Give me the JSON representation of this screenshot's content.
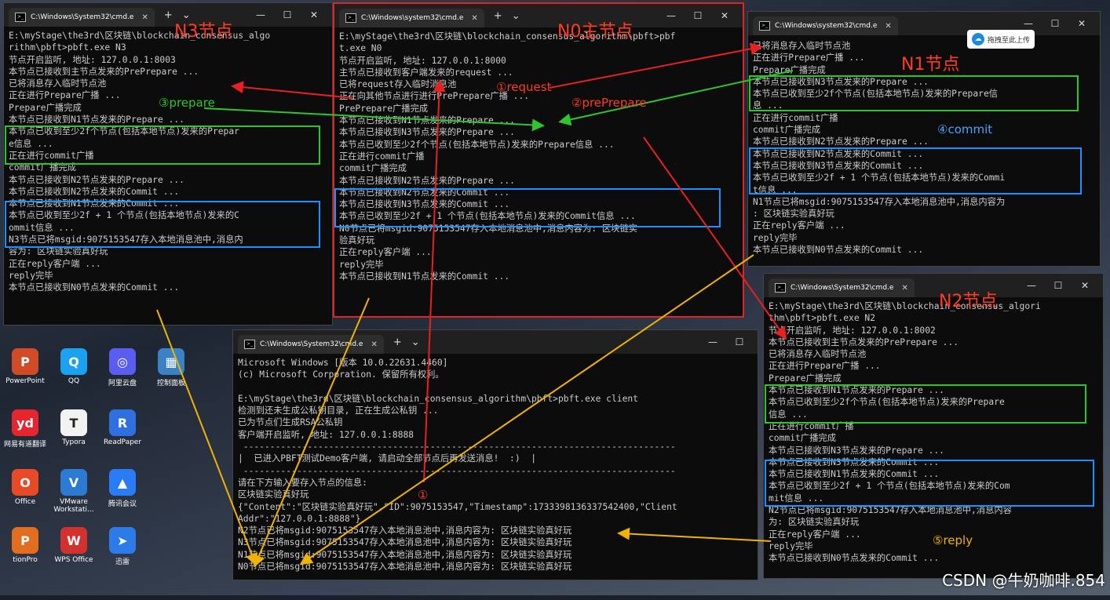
{
  "windows": {
    "n3": {
      "tab_title": "C:\\Windows\\System32\\cmd.e",
      "lines": [
        "E:\\myStage\\the3rd\\区块链\\blockchain_consensus_algo",
        "rithm\\pbft>pbft.exe N3",
        "节点开启监听, 地址: 127.0.0.1:8003",
        "本节点已接收到主节点发来的PrePrepare ...",
        "已将消息存入临时节点池",
        "正在进行Prepare广播 ...",
        "Prepare广播完成",
        "本节点已接收到N1节点发来的Prepare ...",
        "本节点已收到至少2f个节点(包括本地节点)发来的Prepar",
        "e信息 ...",
        "正在进行commit广播",
        "commit广播完成",
        "本节点已接收到N2节点发来的Prepare ...",
        "本节点已接收到N2节点发来的Commit ...",
        "本节点已接收到N1节点发来的Commit ...",
        "本节点已收到至少2f + 1 个节点(包括本地节点)发来的C",
        "ommit信息 ...",
        "N3节点已将msgid:9075153547存入本地消息池中,消息内",
        "容为: 区块链实验真好玩",
        "正在reply客户端 ...",
        "reply完毕",
        "本节点已接收到N0节点发来的Commit ..."
      ]
    },
    "n0": {
      "tab_title": "C:\\Windows\\system32\\cmd.e",
      "lines": [
        "E:\\myStage\\the3rd\\区块链\\blockchain_consensus_algorithm\\pbft>pbf",
        "t.exe N0",
        "节点开启监听, 地址: 127.0.0.1:8000",
        "主节点已接收到客户端发来的request ...",
        "已将request存入临时消息池",
        "正在向其他节点进行进行PrePrepare广播 ...",
        "PrePrepare广播完成",
        "本节点已接收到N1节点发来的Prepare ...",
        "本节点已接收到N3节点发来的Prepare ...",
        "本节点已收到至少2f个节点(包括本地节点)发来的Prepare信息 ...",
        "正在进行commit广播",
        "commit广播完成",
        "本节点已接收到N2节点发来的Prepare ...",
        "本节点已接收到N2节点发来的Commit ...",
        "本节点已接收到N3节点发来的Commit ...",
        "本节点已收到至少2f + 1 个节点(包括本地节点)发来的Commit信息 ...",
        "N0节点已将msgid:9075153547存入本地消息池中,消息内容为: 区块链实",
        "验真好玩",
        "正在reply客户端 ...",
        "reply完毕",
        "本节点已接收到N1节点发来的Commit ..."
      ]
    },
    "n1": {
      "tab_title": "C:\\Windows\\system32\\cmd.e",
      "lines": [
        "已将消息存入临时节点池",
        "正在进行Prepare广播 ...",
        "Prepare广播完成",
        "本节点已接收到N3节点发来的Prepare ...",
        "本节点已收到至少2f个节点(包括本地节点)发来的Prepare信",
        "息 ...",
        "正在进行commit广播",
        "commit广播完成",
        "本节点已接收到N2节点发来的Prepare ...",
        "本节点已接收到N2节点发来的Commit ...",
        "本节点已接收到N3节点发来的Commit ...",
        "本节点已收到至少2f + 1 个节点(包括本地节点)发来的Commi",
        "t信息 ...",
        "N1节点已将msgid:9075153547存入本地消息池中,消息内容为",
        ": 区块链实验真好玩",
        "正在reply客户端 ...",
        "reply完毕",
        "本节点已接收到N0节点发来的Commit ..."
      ]
    },
    "n2": {
      "tab_title": "C:\\Windows\\System32\\cmd.e",
      "lines": [
        "E:\\myStage\\the3rd\\区块链\\blockchain_consensus_algori",
        "thm\\pbft>pbft.exe N2",
        "节点开启监听, 地址: 127.0.0.1:8002",
        "本节点已接收到主节点发来的PrePrepare ...",
        "已将消息存入临时节点池",
        "正在进行Prepare广播 ...",
        "Prepare广播完成",
        "本节点已接收到N1节点发来的Prepare ...",
        "本节点已收到至少2f个节点(包括本地节点)发来的Prepare",
        "信息 ...",
        "正在进行commit广播",
        "commit广播完成",
        "本节点已接收到N3节点发来的Prepare ...",
        "本节点已接收到N3节点发来的Commit ...",
        "本节点已接收到N1节点发来的Commit ...",
        "本节点已收到至少2f + 1 个节点(包括本地节点)发来的Com",
        "mit信息 ...",
        "N2节点已将msgid:9075153547存入本地消息池中,消息内容",
        "为: 区块链实验真好玩",
        "正在reply客户端 ...",
        "reply完毕",
        "本节点已接收到N0节点发来的Commit ..."
      ]
    },
    "client": {
      "tab_title": "C:\\Windows\\System32\\cmd.e",
      "lines": [
        "Microsoft Windows [版本 10.0.22631.4460]",
        "(c) Microsoft Corporation. 保留所有权利。",
        "",
        "E:\\myStage\\the3rd\\区块链\\blockchain_consensus_algorithm\\pbft>pbft.exe client",
        "检测到还未生成公私钥目录, 正在生成公私钥 ...",
        "已为节点们生成RSA公私钥",
        "客户端开启监听, 地址: 127.0.0.1:8888",
        " ---------------------------------------------------------------------------------",
        "|  已进入PBFT测试Demo客户端, 请启动全部节点后再发送消息!  :)  |",
        " ---------------------------------------------------------------------------------",
        "请在下方输入要存入节点的信息:",
        "区块链实验真好玩",
        "{\"Content\":\"区块链实验真好玩\",\"ID\":9075153547,\"Timestamp\":1733398136337542400,\"Client",
        "Addr\":\"127.0.0.1:8888\"}",
        "N2节点已将msgid:9075153547存入本地消息池中,消息内容为: 区块链实验真好玩",
        "N3节点已将msgid:9075153547存入本地消息池中,消息内容为: 区块链实验真好玩",
        "N1节点已将msgid:9075153547存入本地消息池中,消息内容为: 区块链实验真好玩",
        "N0节点已将msgid:9075153547存入本地消息池中,消息内容为: 区块链实验真好玩"
      ]
    }
  },
  "annotations": {
    "n3_label": "N3节点",
    "n0_label": "N0主节点",
    "n1_label": "N1节点",
    "n2_label": "N2节点",
    "step1": "①request",
    "step2": "②prePrepare",
    "step3": "③prepare",
    "step4": "④commit",
    "step5": "⑤reply",
    "client_mark": "①"
  },
  "upload_badge": "拖拽至此上传",
  "desktop_icons": [
    {
      "label": "PowerPoint",
      "icon": "powerpoint-icon",
      "color": "#d04a26",
      "glyph": "P"
    },
    {
      "label": "QQ",
      "icon": "qq-icon",
      "color": "#1aa1f0",
      "glyph": "Q"
    },
    {
      "label": "阿里云盘",
      "icon": "aliyun-drive-icon",
      "color": "#5a5ef0",
      "glyph": "◎"
    },
    {
      "label": "控制面板",
      "icon": "control-panel-icon",
      "color": "#3b82c4",
      "glyph": "▦"
    },
    {
      "label": "网易有道翻译",
      "icon": "youdao-icon",
      "color": "#e5262e",
      "glyph": "yd"
    },
    {
      "label": "Typora",
      "icon": "typora-icon",
      "color": "#f2f2f2",
      "glyph": "T"
    },
    {
      "label": "ReadPaper",
      "icon": "readpaper-icon",
      "color": "#2f6fe0",
      "glyph": "R"
    },
    {
      "label": "Office",
      "icon": "office-icon",
      "color": "#e94a26",
      "glyph": "O"
    },
    {
      "label": "VMware Workstati...",
      "icon": "vmware-icon",
      "color": "#2b7bd4",
      "glyph": "V"
    },
    {
      "label": "腾讯会议",
      "icon": "tencent-meeting-icon",
      "color": "#2a7cf6",
      "glyph": "▲"
    },
    {
      "label": "tionPro",
      "icon": "pro-app-icon",
      "color": "#e36d1f",
      "glyph": "P"
    },
    {
      "label": "WPS Office",
      "icon": "wps-icon",
      "color": "#d3312d",
      "glyph": "W"
    },
    {
      "label": "迅雷",
      "icon": "xunlei-icon",
      "color": "#2d7be8",
      "glyph": "➤"
    }
  ],
  "watermark": "CSDN @牛奶咖啡.854",
  "colors": {
    "node_label": "#ff3b20",
    "prepare_box": "#2ec52e",
    "commit_box": "#1e90ff",
    "request_arrow": "#e82020",
    "prepare_arrow": "#2ec52e",
    "commit_label": "#4aa3ff",
    "reply_arrow": "#f0b400"
  }
}
